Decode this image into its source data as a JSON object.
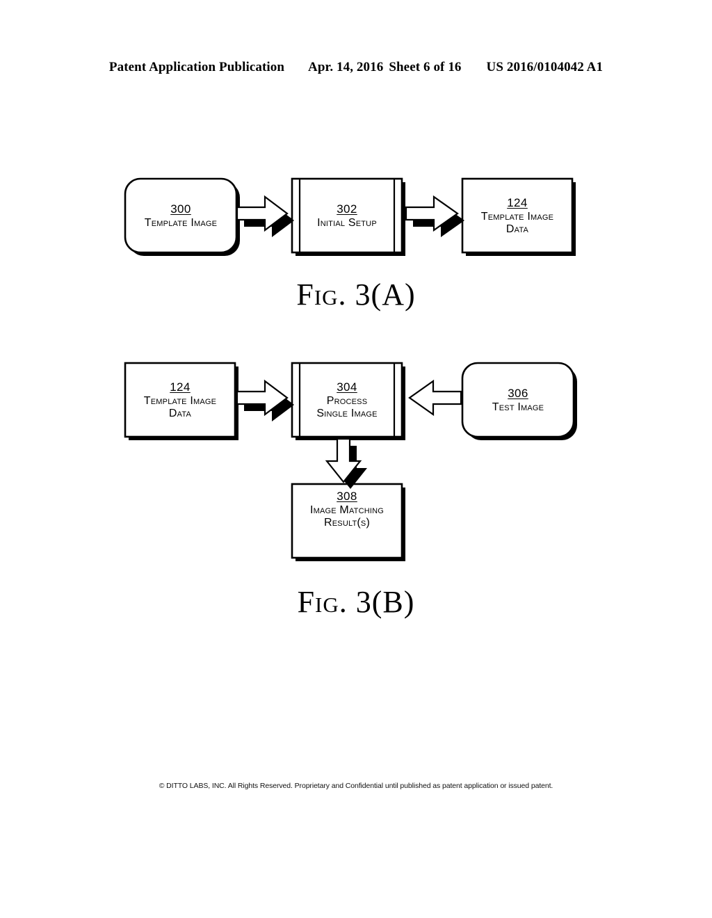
{
  "header": {
    "title": "Patent Application Publication",
    "date": "Apr. 14, 2016",
    "sheet": "Sheet 6 of 16",
    "publication_number": "US 2016/0104042 A1"
  },
  "figures": [
    {
      "caption": "Fig. 3(A)",
      "nodes": [
        {
          "id": "300",
          "number": "300",
          "label_lines": [
            "Template Image"
          ],
          "shape": "rounded-rectangle"
        },
        {
          "id": "302",
          "number": "302",
          "label_lines": [
            "Initial Setup"
          ],
          "shape": "process-box"
        },
        {
          "id": "124a",
          "number": "124",
          "label_lines": [
            "Template Image",
            "Data"
          ],
          "shape": "rectangle"
        }
      ],
      "arrows": [
        {
          "from": "300",
          "to": "302",
          "direction": "right"
        },
        {
          "from": "302",
          "to": "124a",
          "direction": "right"
        }
      ]
    },
    {
      "caption": "Fig. 3(B)",
      "nodes": [
        {
          "id": "124b",
          "number": "124",
          "label_lines": [
            "Template Image",
            "Data"
          ],
          "shape": "rectangle"
        },
        {
          "id": "304",
          "number": "304",
          "label_lines": [
            "Process",
            "Single Image"
          ],
          "shape": "process-box"
        },
        {
          "id": "306",
          "number": "306",
          "label_lines": [
            "Test Image"
          ],
          "shape": "rounded-rectangle"
        },
        {
          "id": "308",
          "number": "308",
          "label_lines": [
            "Image Matching",
            "Result(s)"
          ],
          "shape": "rectangle"
        }
      ],
      "arrows": [
        {
          "from": "124b",
          "to": "304",
          "direction": "right"
        },
        {
          "from": "306",
          "to": "304",
          "direction": "left"
        },
        {
          "from": "304",
          "to": "308",
          "direction": "down"
        }
      ]
    }
  ],
  "footer": {
    "notice": "© DITTO LABS, INC.  All Rights Reserved.  Proprietary and Confidential until published as patent application or issued patent."
  },
  "colors": {
    "ink": "#000000",
    "paper": "#ffffff"
  }
}
